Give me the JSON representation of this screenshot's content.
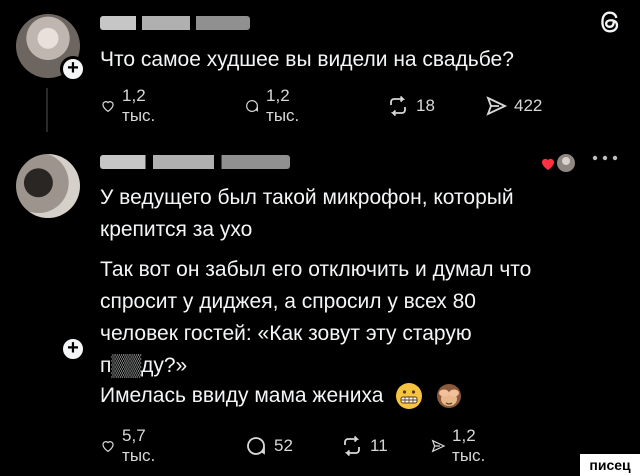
{
  "post1": {
    "text": "Что самое худшее вы видели на свадьбе?",
    "actions": {
      "likes": "1,2 тыс.",
      "comments": "1,2 тыс.",
      "reposts": "18",
      "shares": "422"
    }
  },
  "post2": {
    "lines": [
      "У ведущего был такой микрофон, который",
      "крепится за ухо",
      "Так вот он забыл его отключить и думал что",
      "спросит у диджея, а спросил у всех 80",
      "человек гостей: «Как зовут эту старую",
      "п▒▒ду?»",
      "Имелась ввиду мама жениха"
    ],
    "actions": {
      "likes": "5,7 тыс.",
      "comments": "52",
      "reposts": "11",
      "shares": "1,2 тыс."
    }
  },
  "icons": [
    "threads-icon",
    "plus-icon",
    "heart-icon",
    "comment-icon",
    "repost-icon",
    "share-icon",
    "more-icon",
    "grimace-emoji",
    "see-no-evil-monkey-emoji"
  ],
  "watermark": "писец"
}
